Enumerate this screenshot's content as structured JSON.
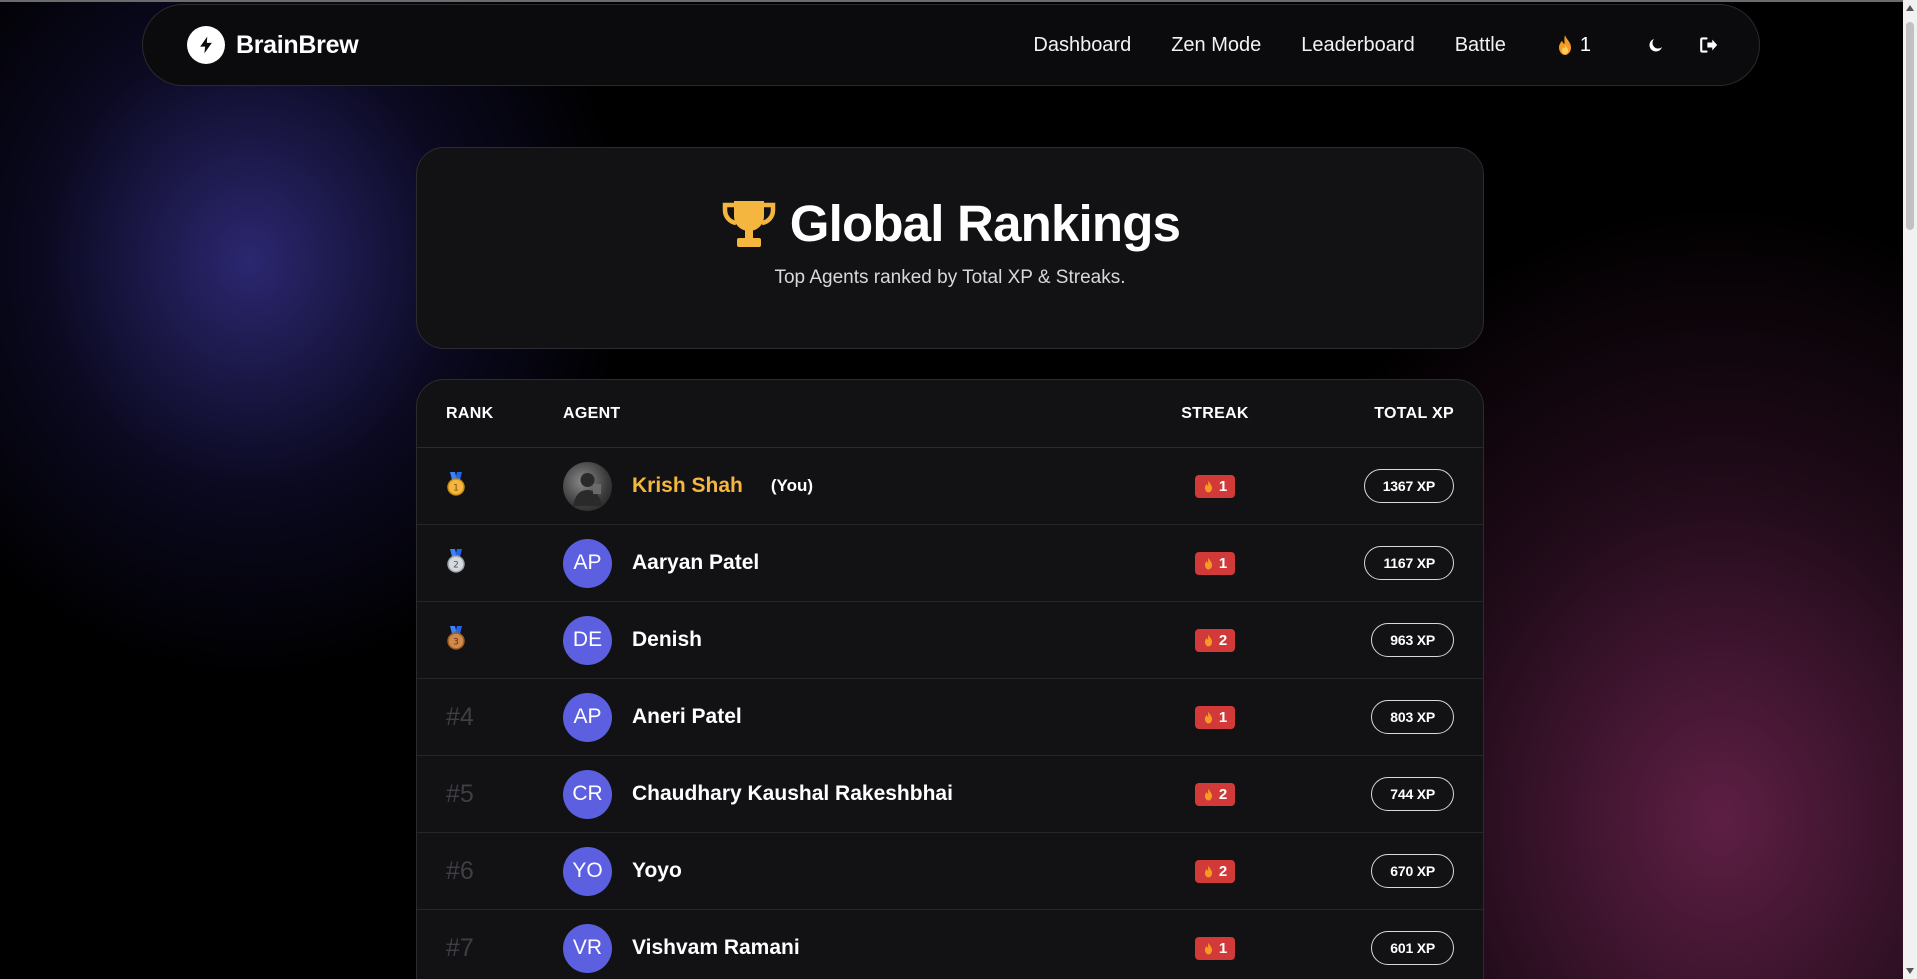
{
  "nav": {
    "brand": "BrainBrew",
    "links": [
      "Dashboard",
      "Zen Mode",
      "Leaderboard",
      "Battle"
    ],
    "streak_count": "1"
  },
  "hero": {
    "title": "Global Rankings",
    "subtitle": "Top Agents ranked by Total XP & Streaks."
  },
  "table": {
    "headers": {
      "rank": "RANK",
      "agent": "AGENT",
      "streak": "STREAK",
      "xp": "TOTAL XP"
    },
    "rows": [
      {
        "rank": "1",
        "medal": "gold",
        "initials": "",
        "name": "Krish Shah",
        "tag": "(You)",
        "streak": "1",
        "xp": "1367 XP"
      },
      {
        "rank": "2",
        "medal": "silver",
        "initials": "AP",
        "name": "Aaryan Patel",
        "tag": "",
        "streak": "1",
        "xp": "1167 XP"
      },
      {
        "rank": "3",
        "medal": "bronze",
        "initials": "DE",
        "name": "Denish",
        "tag": "",
        "streak": "2",
        "xp": "963 XP"
      },
      {
        "rank": "#4",
        "medal": "",
        "initials": "AP",
        "name": "Aneri Patel",
        "tag": "",
        "streak": "1",
        "xp": "803 XP"
      },
      {
        "rank": "#5",
        "medal": "",
        "initials": "CR",
        "name": "Chaudhary Kaushal Rakeshbhai",
        "tag": "",
        "streak": "2",
        "xp": "744 XP"
      },
      {
        "rank": "#6",
        "medal": "",
        "initials": "YO",
        "name": "Yoyo",
        "tag": "",
        "streak": "2",
        "xp": "670 XP"
      },
      {
        "rank": "#7",
        "medal": "",
        "initials": "VR",
        "name": "Vishvam Ramani",
        "tag": "",
        "streak": "1",
        "xp": "601 XP"
      }
    ]
  },
  "colors": {
    "accent_gold": "#f5b640",
    "avatar_bg": "#5b5fe0",
    "streak_badge": "#d23a3a"
  },
  "icons": {
    "brand": "lightning-bolt-icon",
    "streak": "flame-icon",
    "theme": "moon-icon",
    "logout": "logout-icon",
    "hero": "trophy-icon",
    "medals": [
      "gold-medal-icon",
      "silver-medal-icon",
      "bronze-medal-icon"
    ]
  }
}
